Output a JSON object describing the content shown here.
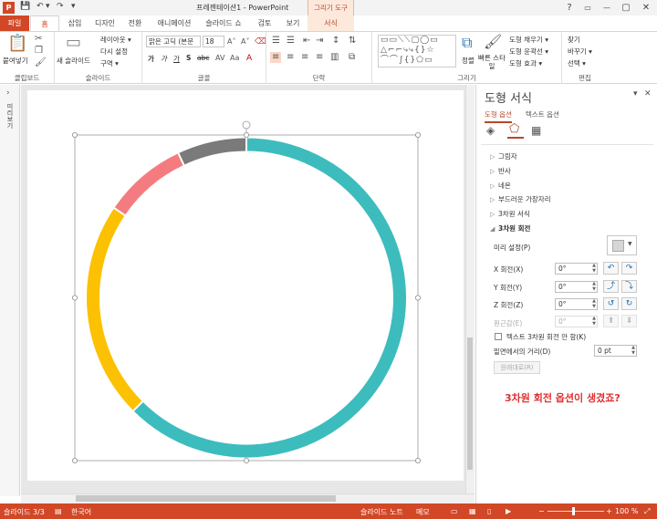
{
  "app": {
    "title": "프레젠테이션1 - PowerPoint",
    "context_group": "그리기 도구",
    "app_icon_letter": "P"
  },
  "window_controls": {
    "help": "?",
    "ribbon_opts": "▭",
    "minimize": "—",
    "restore": "▢",
    "close": "✕"
  },
  "quick_access": {
    "save": "💾",
    "undo": "↶",
    "undo_menu": "▾",
    "redo": "↷",
    "customize": "▾"
  },
  "tabs": [
    "파일",
    "홈",
    "삽입",
    "디자인",
    "전환",
    "애니메이션",
    "슬라이드 쇼",
    "검토",
    "보기",
    "서식"
  ],
  "ribbon": {
    "clipboard": {
      "paste": "붙여넣기",
      "label": "클립보드"
    },
    "slides": {
      "new_slide": "새 슬라이드",
      "layout": "레이아웃 ▾",
      "reset": "다시 설정",
      "section": "구역 ▾",
      "label": "슬라이드"
    },
    "font": {
      "font_name": "맑은 고딕 (본문",
      "font_size": "18",
      "bold": "가",
      "italic": "가",
      "underline": "가",
      "shadow": "S",
      "strike": "abc",
      "label": "글꼴"
    },
    "paragraph": {
      "label": "단락"
    },
    "drawing": {
      "arrange": "정렬",
      "quick_styles": "빠른 스타일",
      "shape_fill": "도형 채우기 ▾",
      "shape_outline": "도형 윤곽선 ▾",
      "shape_effects": "도형 효과 ▾",
      "label": "그리기"
    },
    "editing": {
      "find": "찾기",
      "replace": "바꾸기 ▾",
      "select": "선택 ▾",
      "label": "편집"
    }
  },
  "thumb_panel": {
    "label": "미리보기",
    "toggle": "›"
  },
  "chart_data": {
    "type": "pie",
    "categories": [
      "teal",
      "yellow",
      "pink",
      "gray"
    ],
    "values": [
      62.5,
      22,
      8.5,
      7
    ],
    "colors": [
      "#3dbcbe",
      "#fbc102",
      "#f47c81",
      "#7a7a7a"
    ]
  },
  "pane": {
    "title": "도형 서식",
    "pin": "▾",
    "close": "✕",
    "tab_shape": "도형 옵션",
    "tab_text": "텍스트 옵션",
    "sections": [
      "그림자",
      "반사",
      "네온",
      "부드러운 가장자리",
      "3차원 서식",
      "3차원 회전"
    ],
    "preset_label": "미리 설정(P)",
    "x_label": "X 회전(X)",
    "x_value": "0°",
    "y_label": "Y 회전(Y)",
    "y_value": "0°",
    "z_label": "Z 회전(Z)",
    "z_value": "0°",
    "persp_label": "원근감(E)",
    "persp_value": "0°",
    "keep_text_flat": "텍스트 3차원 회전 안 함(K)",
    "distance_label": "밑면에서의 거리(D)",
    "distance_value": "0 pt",
    "reset": "원래대로(R)",
    "annotation": "3차원 회전 옵션이 생겼죠?"
  },
  "statusbar": {
    "slide": "슬라이드 3/3",
    "lang": "한국어",
    "notes": "슬라이드 노트",
    "comments": "메모",
    "zoom": "100 %"
  }
}
